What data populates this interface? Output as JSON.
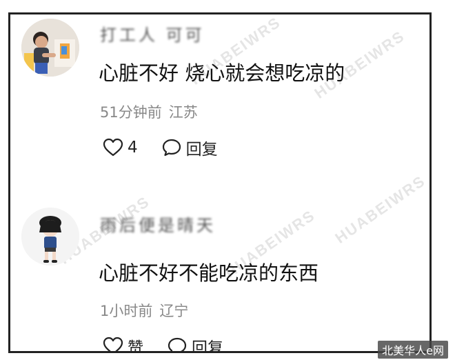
{
  "comments": [
    {
      "username": "打工人 可可",
      "content": "心脏不好 烧心就会想吃凉的",
      "time": "51分钟前",
      "location": "江苏",
      "like_count": "4",
      "reply_label": "回复"
    },
    {
      "username": "雨后便是晴天",
      "content": "心脏不好不能吃凉的东西",
      "time": "1小时前",
      "location": "辽宁",
      "like_label": "赞",
      "reply_label": "回复"
    }
  ],
  "site_badge": "北美华人e网",
  "colors": {
    "text_primary": "#111111",
    "text_meta": "#888888",
    "border": "#222222"
  }
}
